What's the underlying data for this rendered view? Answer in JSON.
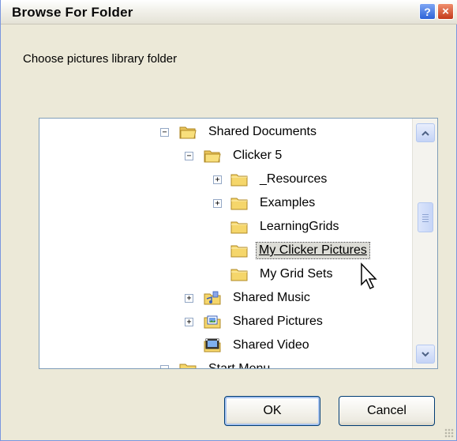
{
  "window": {
    "title": "Browse For Folder",
    "help_glyph": "?",
    "close_glyph": "×"
  },
  "prompt": "Choose pictures library folder",
  "tree": {
    "nodes": [
      {
        "label": "Shared Documents",
        "expander": "−",
        "icon": "folder-open-icon"
      },
      {
        "label": "Clicker 5",
        "expander": "−",
        "icon": "folder-open-icon"
      },
      {
        "label": "_Resources",
        "expander": "+",
        "icon": "folder-icon"
      },
      {
        "label": "Examples",
        "expander": "+",
        "icon": "folder-icon"
      },
      {
        "label": "LearningGrids",
        "expander": "",
        "icon": "folder-icon"
      },
      {
        "label": "My Clicker Pictures",
        "expander": "",
        "icon": "folder-icon",
        "selected": true
      },
      {
        "label": "My Grid Sets",
        "expander": "",
        "icon": "folder-icon"
      },
      {
        "label": "Shared Music",
        "expander": "+",
        "icon": "music-folder-icon"
      },
      {
        "label": "Shared Pictures",
        "expander": "+",
        "icon": "pictures-folder-icon"
      },
      {
        "label": "Shared Video",
        "expander": "",
        "icon": "video-folder-icon"
      },
      {
        "label": "Start Menu",
        "expander": "−",
        "icon": "folder-icon"
      }
    ]
  },
  "buttons": {
    "ok": "OK",
    "cancel": "Cancel"
  },
  "colors": {
    "dialog_bg": "#ece9d8",
    "tree_border": "#7f9db9",
    "button_border": "#003c74",
    "folder_yellow": "#f5d66b"
  }
}
